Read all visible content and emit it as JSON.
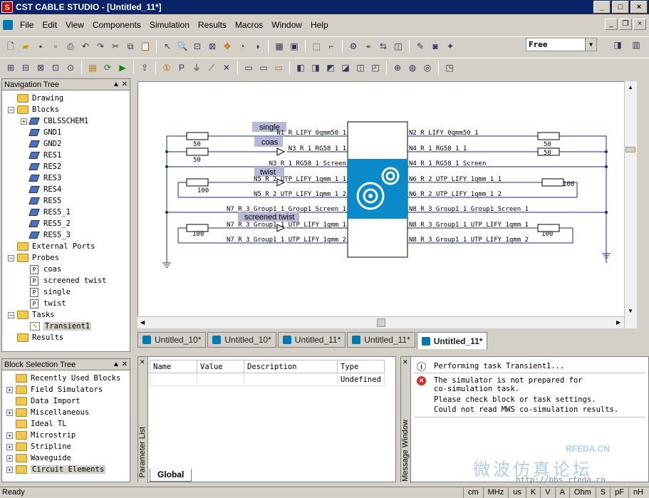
{
  "window": {
    "title": "CST CABLE STUDIO - [Untitled_11*]",
    "min": "_",
    "max": "□",
    "close": "×"
  },
  "menu": [
    "File",
    "Edit",
    "View",
    "Components",
    "Simulation",
    "Results",
    "Macros",
    "Window",
    "Help"
  ],
  "toolbar": {
    "mode_value": "Free"
  },
  "navigation_tree": {
    "title": "Navigation Tree",
    "items": {
      "drawing": "Drawing",
      "blocks": "Blocks",
      "b1": "CBLSSCHEM1",
      "b2": "GND1",
      "b3": "GND2",
      "b4": "RES1",
      "b5": "RES2",
      "b6": "RES3",
      "b7": "RES4",
      "b8": "RES5",
      "b9": "RES5_1",
      "b10": "RES5_2",
      "b11": "RES5_3",
      "ports": "External Ports",
      "probes": "Probes",
      "p1": "coas",
      "p2": "screened twist",
      "p3": "single",
      "p4": "twist",
      "tasks": "Tasks",
      "t1": "Transient1",
      "results": "Results"
    }
  },
  "block_tree": {
    "title": "Block Selection Tree",
    "items": [
      "Recently Used Blocks",
      "Field Simulators",
      "Data Import",
      "Miscellaneous",
      "Ideal TL",
      "Microstrip",
      "Stripline",
      "Waveguide",
      "Circuit Elements"
    ]
  },
  "schematic": {
    "probe_labels": {
      "single": "single",
      "coas": "coas",
      "twist": "twist",
      "screened": "screened twist"
    },
    "left_nodes": {
      "n1": "N1_R_LIFY_0qmm50_1",
      "n3": "N3_R_1_RG58_1_1",
      "n3s": "N3_R_1_RG58_1_Screen",
      "n5": "N5_R_2_UTP_LIFY_1qmm_1_1",
      "n5b": "N5_R_2_UTP_LIFY_1qmm_1_2",
      "n7s": "N7_R_3_Group1_1_Group1_Screen_1",
      "n7": "N7_R_3_Group1_1_UTP_LIFY_1qmm_1",
      "n7b": "N7_R_3_Group1_1_UTP_LIFY_1qmm_2"
    },
    "right_nodes": {
      "n2": "N2_R_LIFY_0qmm50_1",
      "n4": "N4_R_1_RG58_1_1",
      "n4s": "N4_R_1_RG58_1_Screen",
      "n6": "N6_R_2_UTP_LIFY_1qmm_1_1",
      "n6b": "N6_R_2_UTP_LIFY_1qmm_1_2",
      "n8s": "N8_R_3_Group1_1_Group1_Screen_1",
      "n8": "N8_R_3_Group1_1_UTP_LIFY_1qmm_1",
      "n8b": "N8_R_3_Group1_1_UTP_LIFY_1qmm_2"
    },
    "resistors": {
      "r1": "50",
      "r2": "50",
      "r3": "100",
      "r4": "100",
      "r5": "50",
      "r6": "50",
      "r7": "100",
      "r8": "100"
    }
  },
  "tabs": [
    "Untitled_10*",
    "Untitled_10*",
    "Untitled_11*",
    "Untitled_11*",
    "Untitled_11*"
  ],
  "parameter_list": {
    "label": "Parameter List",
    "columns": {
      "name": "Name",
      "value": "Value",
      "description": "Description",
      "type": "Type"
    },
    "row_type": "Undefined",
    "tab": "Global"
  },
  "message_window": {
    "label": "Message Window",
    "m1": "Performing task Transient1...",
    "m2a": "The simulator is not prepared for",
    "m2b": "co-simulation task.",
    "m2c": "Please check block or task settings.",
    "m2d": "Could not read MWS co-simulation results."
  },
  "status": {
    "text": "Ready",
    "units": [
      "cm",
      "MHz",
      "us",
      "K",
      "V",
      "A",
      "Ohm",
      "S",
      "pF",
      "nH"
    ]
  },
  "watermark": {
    "line1": "RFEDA.CN",
    "line2": "微波仿真论坛",
    "line3": "http://bbs.rfeda.cn"
  }
}
